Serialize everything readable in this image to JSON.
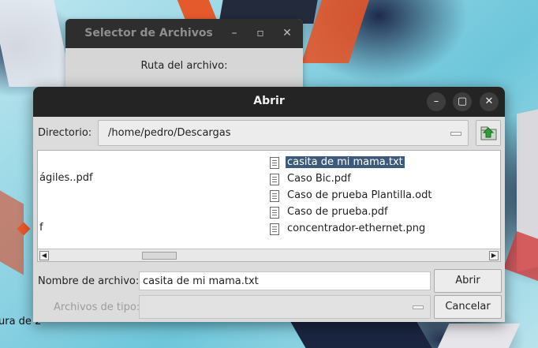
{
  "desktop": {
    "partial_text": "ura de 2"
  },
  "background_window": {
    "title": "Selector de Archivos",
    "minimize_icon": "minimize-icon",
    "maximize_icon": "maximize-icon",
    "close_icon": "close-icon",
    "path_label": "Ruta del archivo:"
  },
  "dialog": {
    "title": "Abrir",
    "controls": {
      "minimize": "–",
      "maximize": "▢",
      "close": "✕"
    },
    "directory": {
      "label": "Directorio:",
      "value": "/home/pedro/Descargas",
      "up_icon": "folder-up-icon"
    },
    "left_column": [
      "ágiles..pdf",
      "f"
    ],
    "files": [
      {
        "name": "casita de mi mama.txt",
        "selected": true,
        "icon": "document-icon"
      },
      {
        "name": "Caso Bic.pdf",
        "selected": false,
        "icon": "document-icon"
      },
      {
        "name": "Caso de prueba Plantilla.odt",
        "selected": false,
        "icon": "document-icon"
      },
      {
        "name": "Caso de prueba.pdf",
        "selected": false,
        "icon": "document-icon"
      },
      {
        "name": "concentrador-ethernet.png",
        "selected": false,
        "icon": "document-icon"
      }
    ],
    "filename": {
      "label": "Nombre de archivo:",
      "value": "casita de mi mama.txt"
    },
    "filetype": {
      "label": "Archivos de tipo:",
      "value": ""
    },
    "buttons": {
      "open": "Abrir",
      "cancel": "Cancelar"
    },
    "scrollbar": {
      "left": "◀",
      "right": "▶"
    },
    "colors": {
      "selection": "#3d5a7a",
      "titlebar": "#242424",
      "up_arrow": "#2e9e3a"
    }
  }
}
